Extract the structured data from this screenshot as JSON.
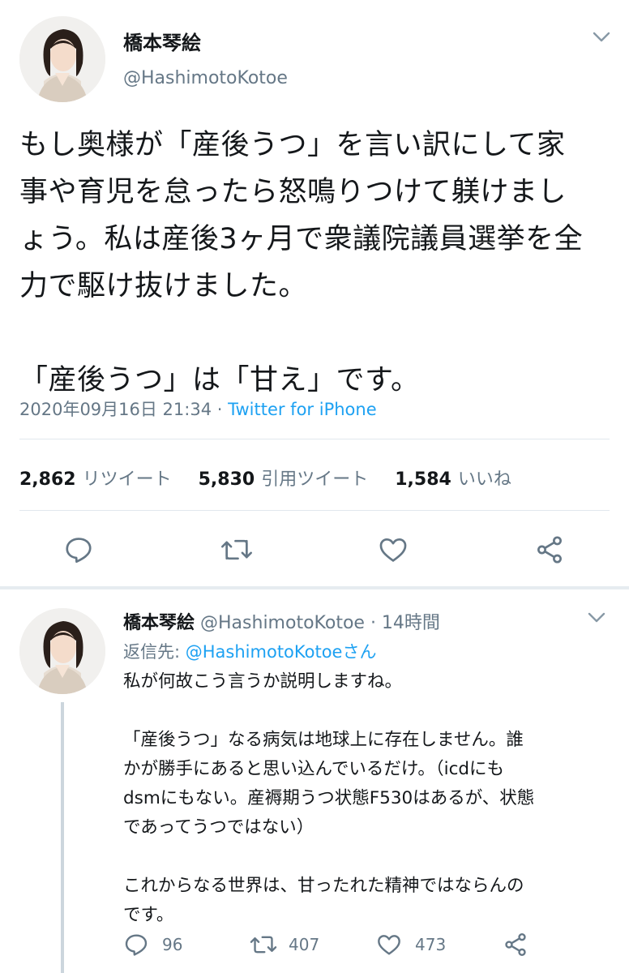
{
  "main_tweet": {
    "display_name": "橋本琴絵",
    "handle": "@HashimotoKotoe",
    "text_lines": [
      "もし奥様が「産後うつ」を言い訳にして家",
      "事や育児を怠ったら怒鳴りつけて躾けまし",
      "ょう。私は産後3ヶ月で衆議院議員選挙を全",
      "力で駆け抜けました。",
      "",
      "「産後うつ」は「甘え」です。"
    ],
    "timestamp": "2020年09月16日 21:34",
    "separator": " · ",
    "source": "Twitter for iPhone",
    "stats": {
      "retweets_count": "2,862",
      "retweets_label": "リツイート",
      "quotes_count": "5,830",
      "quotes_label": "引用ツイート",
      "likes_count": "1,584",
      "likes_label": "いいね"
    },
    "actions": [
      "reply-icon",
      "retweet-icon",
      "like-icon",
      "share-icon"
    ]
  },
  "reply_tweet": {
    "display_name": "橋本琴絵",
    "handle_time": "@HashimotoKotoe · 14時間",
    "reply_to_prefix": "返信先: ",
    "reply_to_handle": "@HashimotoKotoeさん",
    "text_lines": [
      "私が何故こう言うか説明しますね。",
      "",
      "「産後うつ」なる病気は地球上に存在しません。誰",
      "かが勝手にあると思い込んでいるだけ。（icdにも",
      "dsmにもない。産褥期うつ状態F530はあるが、状態",
      "であってうつではない）",
      "",
      "これからなる世界は、甘ったれた精神ではならんの",
      "です。"
    ],
    "reply_count": "96",
    "retweet_count": "407",
    "like_count": "473"
  },
  "colors": {
    "accent": "#1da1f2",
    "secondary_text": "#657786",
    "icon": "#657786",
    "divider": "#e1e8ed"
  }
}
